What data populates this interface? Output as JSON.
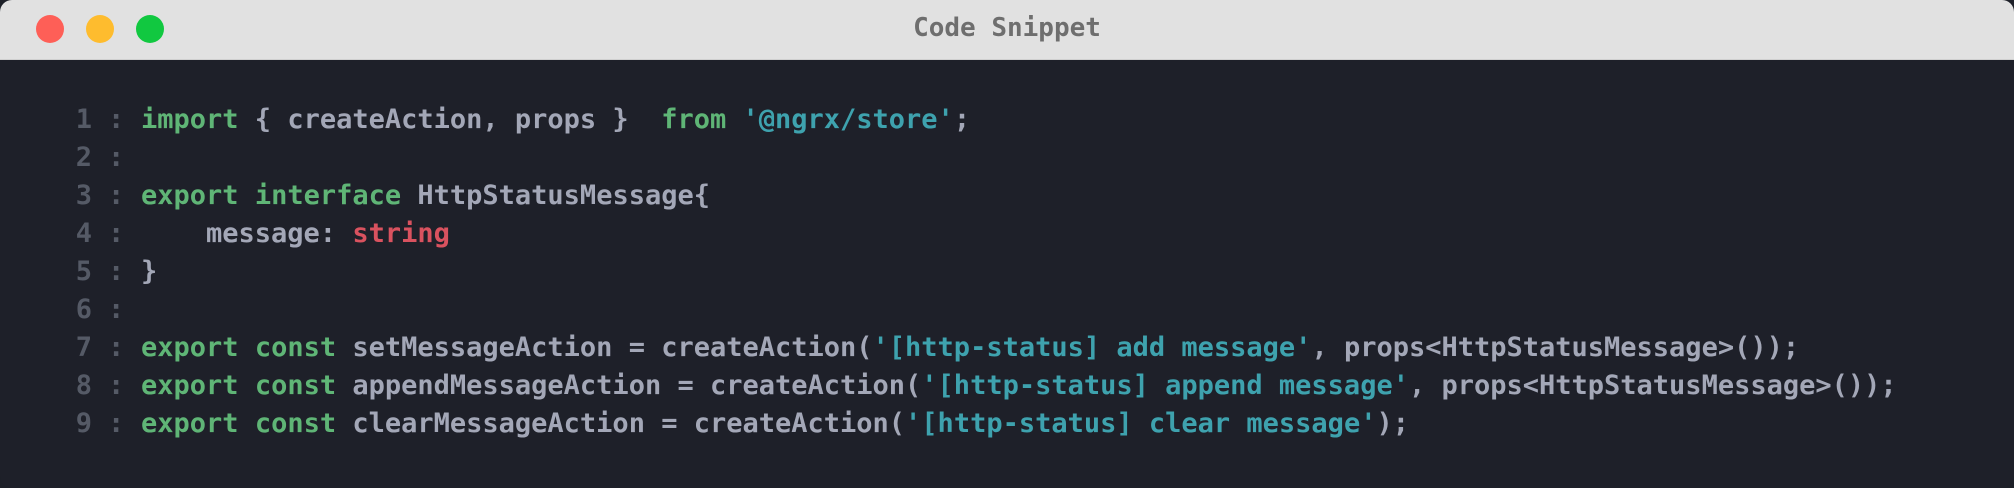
{
  "window": {
    "title": "Code Snippet",
    "controls": {
      "close_color": "#fe5f57",
      "minimize_color": "#febc2e",
      "maximize_color": "#11c840"
    }
  },
  "colors": {
    "background": "#1e2029",
    "titlebar": "#e1e1e1",
    "keyword": "#5fb576",
    "string": "#3ea2ae",
    "type": "#d9525f",
    "plain": "#a3a7b7",
    "line_number": "#555a66"
  },
  "separator": ":",
  "code": {
    "lines": [
      {
        "number": "1",
        "tokens": [
          {
            "t": "kw",
            "v": "import"
          },
          {
            "t": "plain",
            "v": " { createAction, props }  "
          },
          {
            "t": "kw",
            "v": "from"
          },
          {
            "t": "plain",
            "v": " "
          },
          {
            "t": "str",
            "v": "'@ngrx/store'"
          },
          {
            "t": "plain",
            "v": ";"
          }
        ]
      },
      {
        "number": "2",
        "tokens": []
      },
      {
        "number": "3",
        "tokens": [
          {
            "t": "kw",
            "v": "export"
          },
          {
            "t": "plain",
            "v": " "
          },
          {
            "t": "kw",
            "v": "interface"
          },
          {
            "t": "plain",
            "v": " HttpStatusMessage{"
          }
        ]
      },
      {
        "number": "4",
        "tokens": [
          {
            "t": "plain",
            "v": "    message: "
          },
          {
            "t": "type",
            "v": "string"
          }
        ]
      },
      {
        "number": "5",
        "tokens": [
          {
            "t": "plain",
            "v": "}"
          }
        ]
      },
      {
        "number": "6",
        "tokens": []
      },
      {
        "number": "7",
        "tokens": [
          {
            "t": "kw",
            "v": "export"
          },
          {
            "t": "plain",
            "v": " "
          },
          {
            "t": "kw",
            "v": "const"
          },
          {
            "t": "plain",
            "v": " setMessageAction = createAction("
          },
          {
            "t": "str",
            "v": "'[http-status] add message'"
          },
          {
            "t": "plain",
            "v": ", props<HttpStatusMessage>());"
          }
        ]
      },
      {
        "number": "8",
        "tokens": [
          {
            "t": "kw",
            "v": "export"
          },
          {
            "t": "plain",
            "v": " "
          },
          {
            "t": "kw",
            "v": "const"
          },
          {
            "t": "plain",
            "v": " appendMessageAction = createAction("
          },
          {
            "t": "str",
            "v": "'[http-status] append message'"
          },
          {
            "t": "plain",
            "v": ", props<HttpStatusMessage>());"
          }
        ]
      },
      {
        "number": "9",
        "tokens": [
          {
            "t": "kw",
            "v": "export"
          },
          {
            "t": "plain",
            "v": " "
          },
          {
            "t": "kw",
            "v": "const"
          },
          {
            "t": "plain",
            "v": " clearMessageAction = createAction("
          },
          {
            "t": "str",
            "v": "'[http-status] clear message'"
          },
          {
            "t": "plain",
            "v": ");"
          }
        ]
      }
    ]
  }
}
